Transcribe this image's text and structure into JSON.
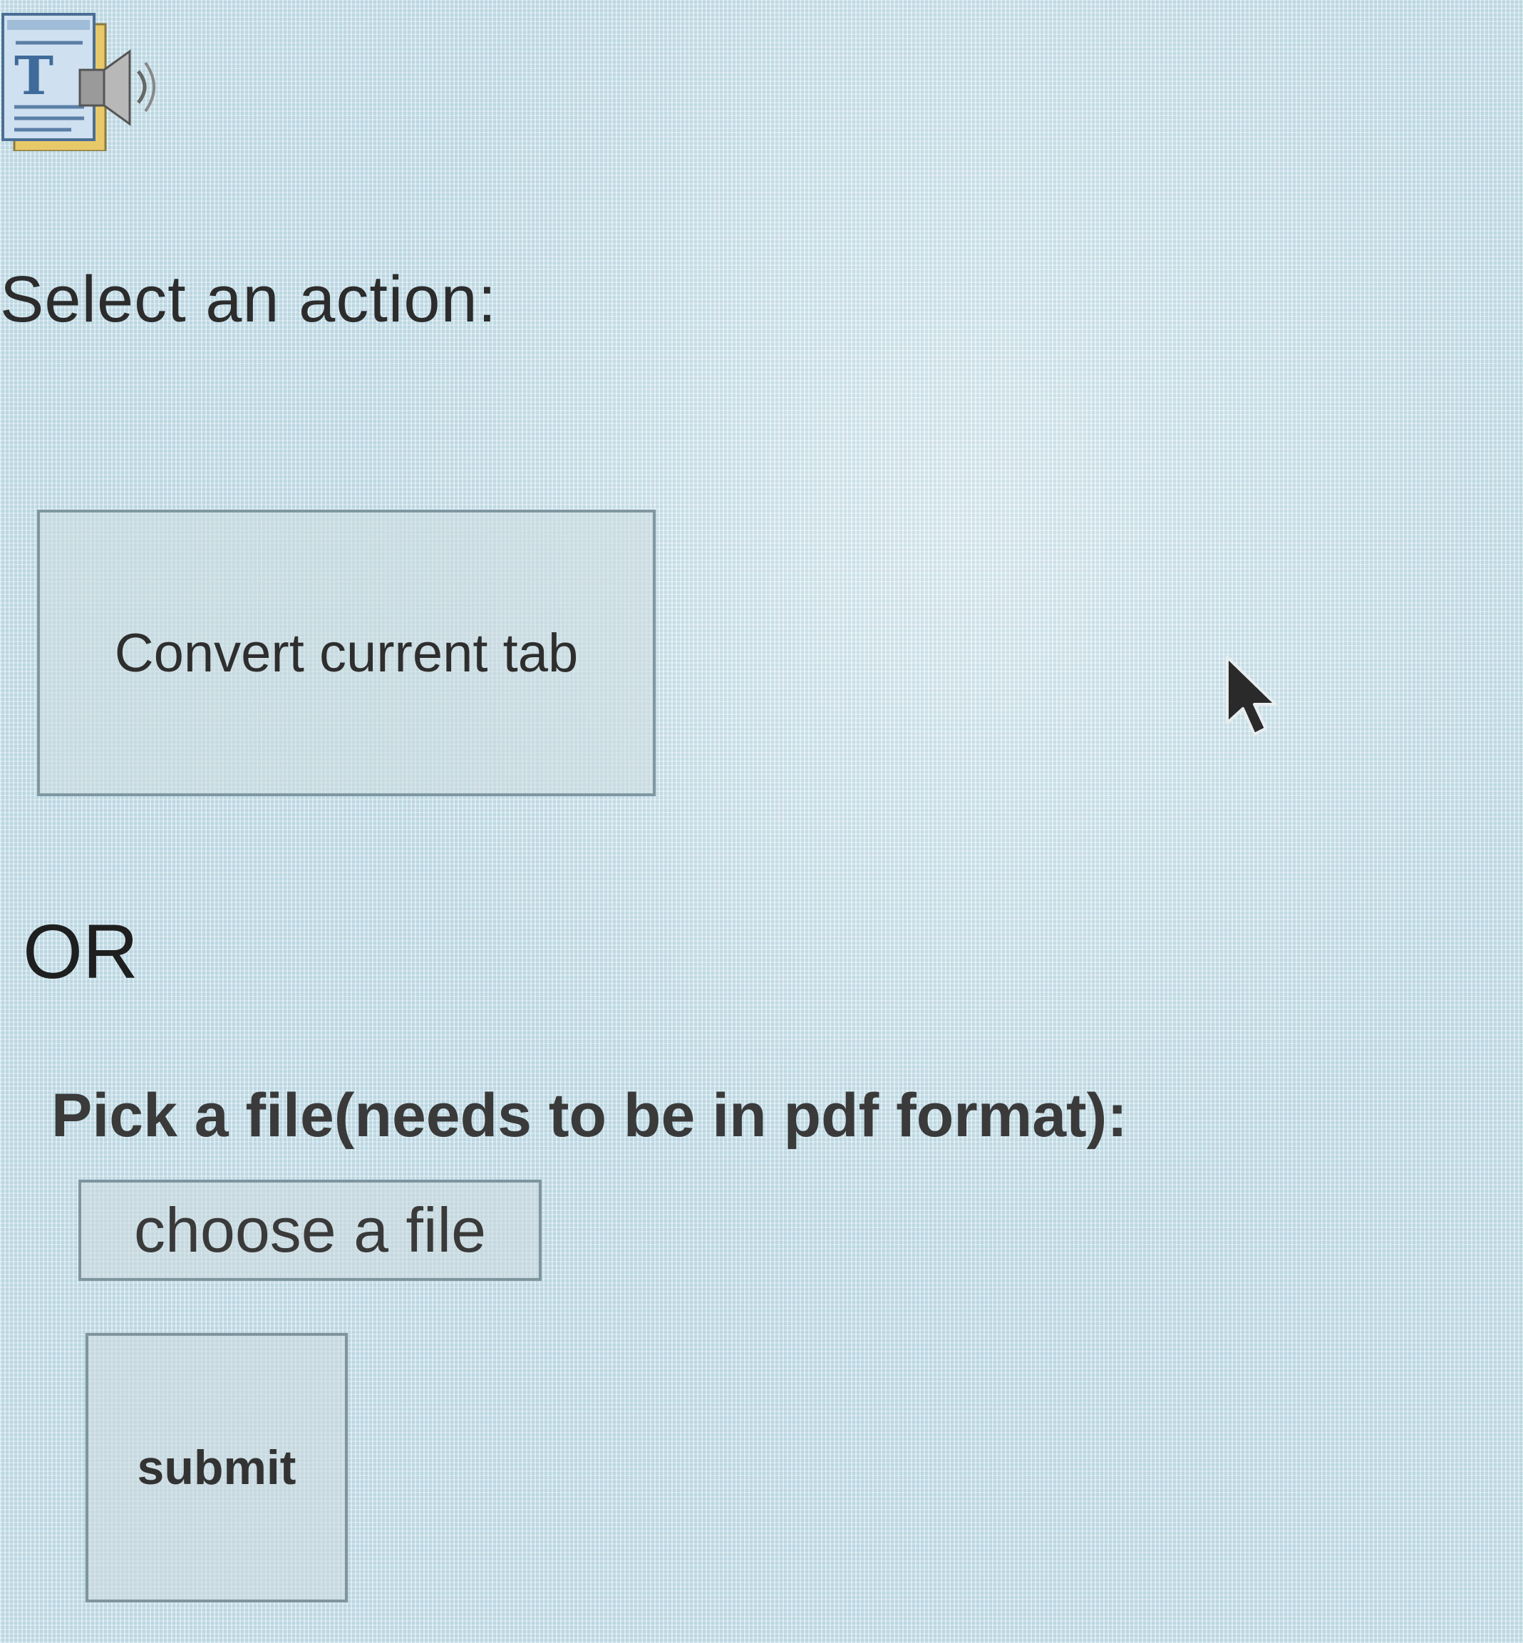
{
  "header": {
    "icon": "text-to-speech-icon"
  },
  "main": {
    "heading": "Select an action:",
    "convert_button_label": "Convert current tab",
    "separator": "OR",
    "file_label": "Pick a file(needs to be in pdf format):",
    "choose_file_label": "choose a file",
    "submit_label": "submit"
  },
  "pointer": {
    "icon": "mouse-cursor-icon"
  },
  "colors": {
    "background": "#c9e1ea",
    "button_border": "#7f97a1",
    "text": "#2b2b2b"
  }
}
